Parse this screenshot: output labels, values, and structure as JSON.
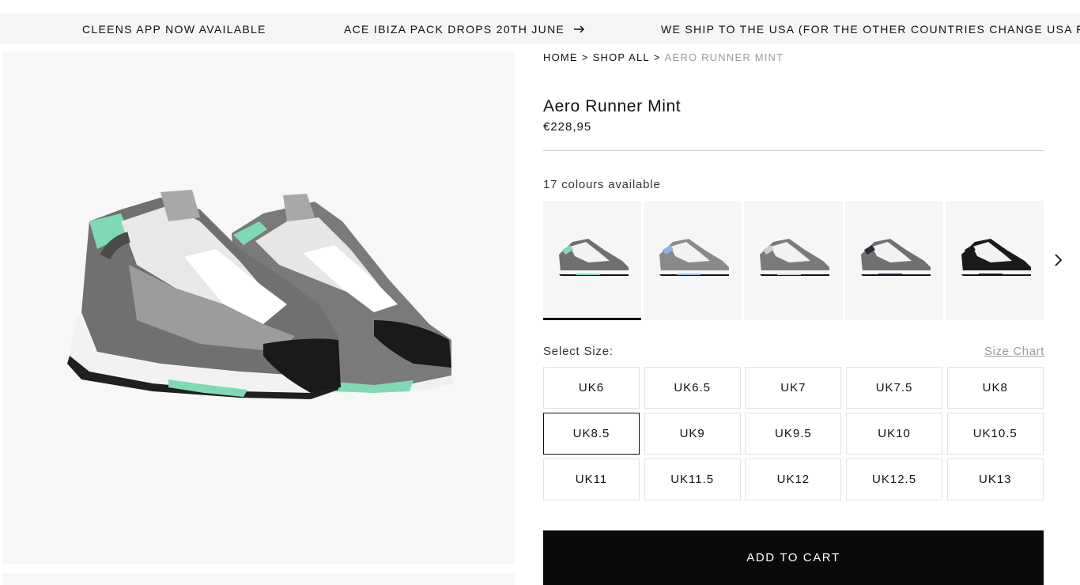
{
  "announcement": {
    "messages": [
      "CLEENS APP NOW AVAILABLE",
      "ACE IBIZA PACK DROPS 20TH JUNE",
      "WE SHIP TO THE USA (FOR THE OTHER COUNTRIES CHANGE USA FOR OTHER"
    ],
    "arrow_icon": "arrow-right-icon"
  },
  "breadcrumb": {
    "home": "HOME",
    "shop_all": "SHOP ALL",
    "current": "AERO RUNNER MINT",
    "separator": ">"
  },
  "product": {
    "title": "Aero Runner Mint",
    "price": "€228,95"
  },
  "colours": {
    "label": "17 colours available",
    "swatches": [
      {
        "name": "mint",
        "accent": "#7fd9b5",
        "body": "#6f6f6f",
        "active": true
      },
      {
        "name": "blue",
        "accent": "#8fb4ea",
        "body": "#8a8a8a",
        "active": false
      },
      {
        "name": "grey",
        "accent": "#cfcfcf",
        "body": "#7a7a7a",
        "active": false
      },
      {
        "name": "black-grey",
        "accent": "#2b2b3a",
        "body": "#707070",
        "active": false
      },
      {
        "name": "black",
        "accent": "#1a1a1a",
        "body": "#1a1a1a",
        "active": false
      }
    ],
    "next_icon": "chevron-right-icon"
  },
  "sizes": {
    "label": "Select Size:",
    "chart_link": "Size Chart",
    "options": [
      "UK6",
      "UK6.5",
      "UK7",
      "UK7.5",
      "UK8",
      "UK8.5",
      "UK9",
      "UK9.5",
      "UK10",
      "UK10.5",
      "UK11",
      "UK11.5",
      "UK12",
      "UK12.5",
      "UK13"
    ],
    "selected": "UK8.5"
  },
  "cart": {
    "button_label": "ADD TO CART"
  },
  "colors": {
    "mint": "#7fd9b5",
    "suede": "#7a7a7a",
    "black": "#0a0a0a"
  }
}
